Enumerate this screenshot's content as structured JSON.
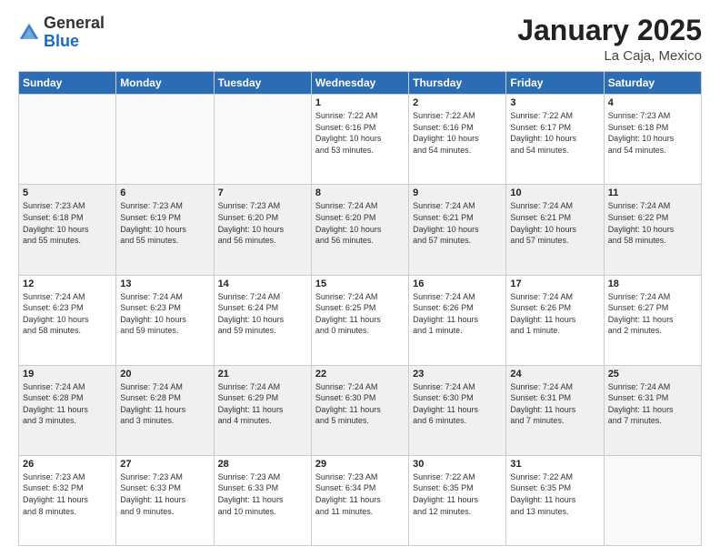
{
  "header": {
    "logo_general": "General",
    "logo_blue": "Blue",
    "month_title": "January 2025",
    "location": "La Caja, Mexico"
  },
  "weekdays": [
    "Sunday",
    "Monday",
    "Tuesday",
    "Wednesday",
    "Thursday",
    "Friday",
    "Saturday"
  ],
  "weeks": [
    [
      {
        "day": "",
        "info": ""
      },
      {
        "day": "",
        "info": ""
      },
      {
        "day": "",
        "info": ""
      },
      {
        "day": "1",
        "info": "Sunrise: 7:22 AM\nSunset: 6:16 PM\nDaylight: 10 hours\nand 53 minutes."
      },
      {
        "day": "2",
        "info": "Sunrise: 7:22 AM\nSunset: 6:16 PM\nDaylight: 10 hours\nand 54 minutes."
      },
      {
        "day": "3",
        "info": "Sunrise: 7:22 AM\nSunset: 6:17 PM\nDaylight: 10 hours\nand 54 minutes."
      },
      {
        "day": "4",
        "info": "Sunrise: 7:23 AM\nSunset: 6:18 PM\nDaylight: 10 hours\nand 54 minutes."
      }
    ],
    [
      {
        "day": "5",
        "info": "Sunrise: 7:23 AM\nSunset: 6:18 PM\nDaylight: 10 hours\nand 55 minutes."
      },
      {
        "day": "6",
        "info": "Sunrise: 7:23 AM\nSunset: 6:19 PM\nDaylight: 10 hours\nand 55 minutes."
      },
      {
        "day": "7",
        "info": "Sunrise: 7:23 AM\nSunset: 6:20 PM\nDaylight: 10 hours\nand 56 minutes."
      },
      {
        "day": "8",
        "info": "Sunrise: 7:24 AM\nSunset: 6:20 PM\nDaylight: 10 hours\nand 56 minutes."
      },
      {
        "day": "9",
        "info": "Sunrise: 7:24 AM\nSunset: 6:21 PM\nDaylight: 10 hours\nand 57 minutes."
      },
      {
        "day": "10",
        "info": "Sunrise: 7:24 AM\nSunset: 6:21 PM\nDaylight: 10 hours\nand 57 minutes."
      },
      {
        "day": "11",
        "info": "Sunrise: 7:24 AM\nSunset: 6:22 PM\nDaylight: 10 hours\nand 58 minutes."
      }
    ],
    [
      {
        "day": "12",
        "info": "Sunrise: 7:24 AM\nSunset: 6:23 PM\nDaylight: 10 hours\nand 58 minutes."
      },
      {
        "day": "13",
        "info": "Sunrise: 7:24 AM\nSunset: 6:23 PM\nDaylight: 10 hours\nand 59 minutes."
      },
      {
        "day": "14",
        "info": "Sunrise: 7:24 AM\nSunset: 6:24 PM\nDaylight: 10 hours\nand 59 minutes."
      },
      {
        "day": "15",
        "info": "Sunrise: 7:24 AM\nSunset: 6:25 PM\nDaylight: 11 hours\nand 0 minutes."
      },
      {
        "day": "16",
        "info": "Sunrise: 7:24 AM\nSunset: 6:26 PM\nDaylight: 11 hours\nand 1 minute."
      },
      {
        "day": "17",
        "info": "Sunrise: 7:24 AM\nSunset: 6:26 PM\nDaylight: 11 hours\nand 1 minute."
      },
      {
        "day": "18",
        "info": "Sunrise: 7:24 AM\nSunset: 6:27 PM\nDaylight: 11 hours\nand 2 minutes."
      }
    ],
    [
      {
        "day": "19",
        "info": "Sunrise: 7:24 AM\nSunset: 6:28 PM\nDaylight: 11 hours\nand 3 minutes."
      },
      {
        "day": "20",
        "info": "Sunrise: 7:24 AM\nSunset: 6:28 PM\nDaylight: 11 hours\nand 3 minutes."
      },
      {
        "day": "21",
        "info": "Sunrise: 7:24 AM\nSunset: 6:29 PM\nDaylight: 11 hours\nand 4 minutes."
      },
      {
        "day": "22",
        "info": "Sunrise: 7:24 AM\nSunset: 6:30 PM\nDaylight: 11 hours\nand 5 minutes."
      },
      {
        "day": "23",
        "info": "Sunrise: 7:24 AM\nSunset: 6:30 PM\nDaylight: 11 hours\nand 6 minutes."
      },
      {
        "day": "24",
        "info": "Sunrise: 7:24 AM\nSunset: 6:31 PM\nDaylight: 11 hours\nand 7 minutes."
      },
      {
        "day": "25",
        "info": "Sunrise: 7:24 AM\nSunset: 6:31 PM\nDaylight: 11 hours\nand 7 minutes."
      }
    ],
    [
      {
        "day": "26",
        "info": "Sunrise: 7:23 AM\nSunset: 6:32 PM\nDaylight: 11 hours\nand 8 minutes."
      },
      {
        "day": "27",
        "info": "Sunrise: 7:23 AM\nSunset: 6:33 PM\nDaylight: 11 hours\nand 9 minutes."
      },
      {
        "day": "28",
        "info": "Sunrise: 7:23 AM\nSunset: 6:33 PM\nDaylight: 11 hours\nand 10 minutes."
      },
      {
        "day": "29",
        "info": "Sunrise: 7:23 AM\nSunset: 6:34 PM\nDaylight: 11 hours\nand 11 minutes."
      },
      {
        "day": "30",
        "info": "Sunrise: 7:22 AM\nSunset: 6:35 PM\nDaylight: 11 hours\nand 12 minutes."
      },
      {
        "day": "31",
        "info": "Sunrise: 7:22 AM\nSunset: 6:35 PM\nDaylight: 11 hours\nand 13 minutes."
      },
      {
        "day": "",
        "info": ""
      }
    ]
  ]
}
